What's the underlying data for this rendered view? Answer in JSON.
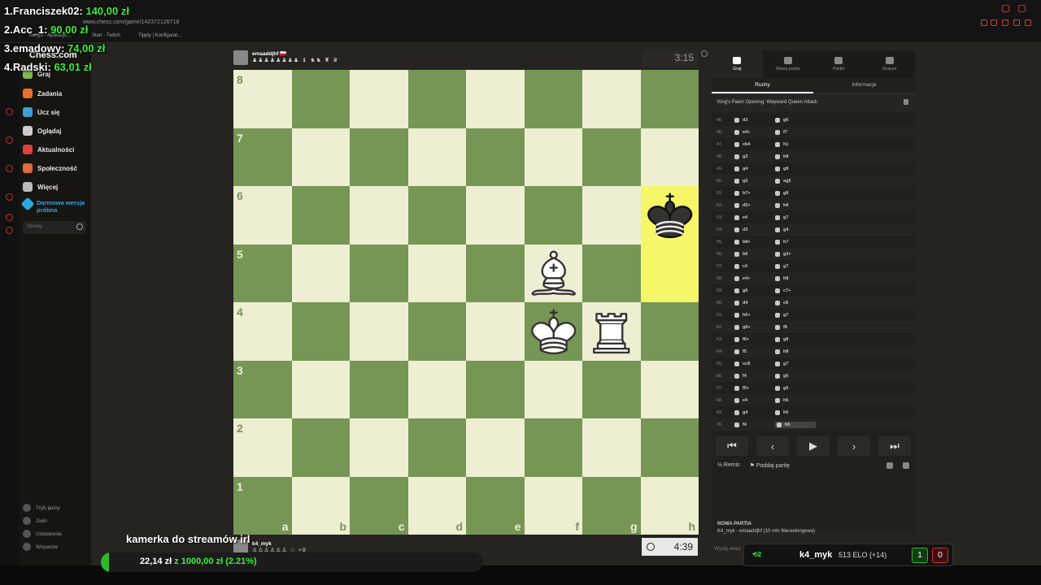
{
  "donors": [
    {
      "name": "1.Franciszek02:",
      "amount": "140,00 zł"
    },
    {
      "name": "2.Acc_1:",
      "amount": "90,00 zł"
    },
    {
      "name": "3.emadowy:",
      "amount": "74,00 zł"
    },
    {
      "name": "4.Radski:",
      "amount": "63,01 zł"
    }
  ],
  "browser": {
    "url": "www.chess.com/game/142372126718",
    "bookmarks": [
      "Kanyo - Aplikacje...",
      "Start - Twitch",
      "Tipply | Konfigurat..."
    ]
  },
  "sidebar": {
    "logo": "Chess.com",
    "items": [
      {
        "label": "Graj",
        "icon": "pawn-icon",
        "color": "#81b64c"
      },
      {
        "label": "Zadania",
        "icon": "puzzle-icon",
        "color": "#e8702a"
      },
      {
        "label": "Ucz się",
        "icon": "lesson-icon",
        "color": "#3ea0d6"
      },
      {
        "label": "Oglądaj",
        "icon": "binoculars-icon",
        "color": "#cccccc"
      },
      {
        "label": "Aktualności",
        "icon": "news-icon",
        "color": "#e04040"
      },
      {
        "label": "Społeczność",
        "icon": "community-icon",
        "color": "#e06a3a"
      },
      {
        "label": "Więcej",
        "icon": "more-icon",
        "color": "#bbbbbb"
      }
    ],
    "promo": "Darmowa wersja próbna",
    "search_placeholder": "Szukaj",
    "bottom": [
      "Tryb jasny",
      "Zwiń",
      "Ustawienia",
      "Wsparcie"
    ]
  },
  "game": {
    "opponent": {
      "name": "emaaddjhf",
      "flag": "🇵🇱",
      "captured": "♟♟♟♟♟♟♟♟ ♝ ♞♞ ♜ ♛",
      "clock": "3:15"
    },
    "player": {
      "name": "k4_myk",
      "captured": "♙♙♙♙♙♙ ♘",
      "extra": "+8",
      "clock": "4:39"
    },
    "ranks": [
      "8",
      "7",
      "6",
      "5",
      "4",
      "3",
      "2",
      "1"
    ],
    "files": [
      "a",
      "b",
      "c",
      "d",
      "e",
      "f",
      "g",
      "h"
    ],
    "pieces": [
      {
        "square": "h6",
        "type": "king",
        "color": "black"
      },
      {
        "square": "f5",
        "type": "bishop",
        "color": "white"
      },
      {
        "square": "f4",
        "type": "king",
        "color": "white"
      },
      {
        "square": "g4",
        "type": "rook",
        "color": "white"
      }
    ],
    "highlights": [
      "h6",
      "h5"
    ]
  },
  "panel": {
    "tabs": [
      {
        "label": "Graj",
        "icon": "play-icon",
        "active": true
      },
      {
        "label": "Nowa partia",
        "icon": "plus-icon",
        "active": false
      },
      {
        "label": "Partie",
        "icon": "games-icon",
        "active": false
      },
      {
        "label": "Gracze",
        "icon": "players-icon",
        "active": false
      }
    ],
    "subtabs": [
      "Ruchy",
      "Informacje"
    ],
    "opening": "King's Pawn Opening: Wayward Queen Attack",
    "moves": [
      {
        "n": "45.",
        "w": "d3",
        "b": "g6"
      },
      {
        "n": "46.",
        "w": "e4+",
        "b": "f7"
      },
      {
        "n": "47.",
        "w": "xb4",
        "b": "h1"
      },
      {
        "n": "48.",
        "w": "g3",
        "b": "h8"
      },
      {
        "n": "49.",
        "w": "g4",
        "b": "g8"
      },
      {
        "n": "50.",
        "w": "g5",
        "b": "xg5"
      },
      {
        "n": "51.",
        "w": "b7+",
        "b": "g8"
      },
      {
        "n": "52.",
        "w": "d5+",
        "b": "h8"
      },
      {
        "n": "53.",
        "w": "e4",
        "b": "g7"
      },
      {
        "n": "54.",
        "w": "d3",
        "b": "g4"
      },
      {
        "n": "55.",
        "w": "b8+",
        "b": "h7"
      },
      {
        "n": "56.",
        "w": "b6",
        "b": "g3+"
      },
      {
        "n": "57.",
        "w": "c4",
        "b": "g7"
      },
      {
        "n": "58.",
        "w": "e4+",
        "b": "h8"
      },
      {
        "n": "59.",
        "w": "g6",
        "b": "c7+"
      },
      {
        "n": "60.",
        "w": "d4",
        "b": "c8"
      },
      {
        "n": "61.",
        "w": "h6+",
        "b": "g7"
      },
      {
        "n": "62.",
        "w": "g6+",
        "b": "f8"
      },
      {
        "n": "63.",
        "w": "f6+",
        "b": "g8"
      },
      {
        "n": "64.",
        "w": "f5",
        "b": "h8"
      },
      {
        "n": "65.",
        "w": "xc8",
        "b": "g7"
      },
      {
        "n": "66.",
        "w": "f4",
        "b": "g6"
      },
      {
        "n": "67.",
        "w": "f5+",
        "b": "g5"
      },
      {
        "n": "68.",
        "w": "e4",
        "b": "h6"
      },
      {
        "n": "69.",
        "w": "g4",
        "b": "h5"
      },
      {
        "n": "70.",
        "w": "f4",
        "b": "h6"
      }
    ],
    "controls": [
      "⏮",
      "‹",
      "▶",
      "›",
      "⏭"
    ],
    "draw": "Remis",
    "resign": "Poddaj partię",
    "new_game_title": "NOWA PARTIA",
    "new_game_desc": "K4_myk - emaaddjhf (10 min Nierankingowa)",
    "chat_placeholder": "Wyślij wiad"
  },
  "stream": {
    "caption": "kamerka do streamów irl",
    "goal_current": "22,14 zł",
    "goal_sep": "z",
    "goal_target": "1000,00 zł",
    "goal_pct": "(2.21%)",
    "goal_fraction": 0.0221
  },
  "score": {
    "streak": "2",
    "name": "k4_myk",
    "elo": "513 ELO (+14)",
    "wins": "1",
    "losses": "0"
  }
}
